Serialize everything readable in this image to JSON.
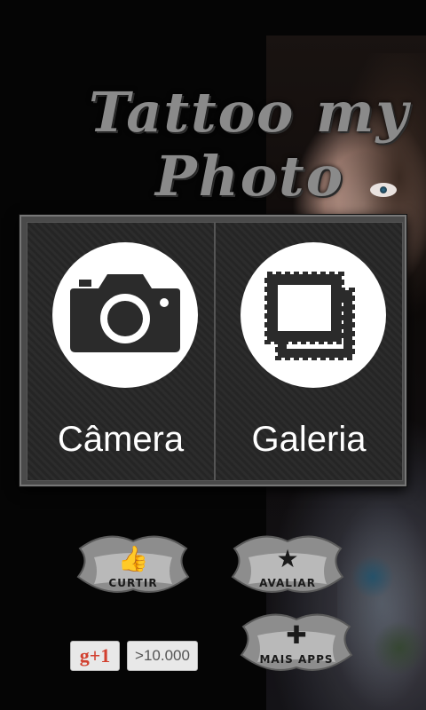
{
  "logo": {
    "line1": "Tattoo my",
    "line2": "Photo"
  },
  "dialog": {
    "camera": {
      "label": "Câmera",
      "icon": "camera-icon"
    },
    "gallery": {
      "label": "Galeria",
      "icon": "gallery-icon"
    }
  },
  "buttons": {
    "like": {
      "label": "CURTIR",
      "icon": "thumbs-up-icon"
    },
    "rate": {
      "label": "AVALIAR",
      "icon": "star-icon"
    },
    "more": {
      "label": "MAIS APPS",
      "icon": "plus-icon"
    }
  },
  "gplus": {
    "label": "g+1",
    "count": ">10.000"
  },
  "colors": {
    "dialog_bg": "#4a4a4a",
    "panel_bg": "#2a2a2a",
    "gplus_red": "#d2402f"
  }
}
